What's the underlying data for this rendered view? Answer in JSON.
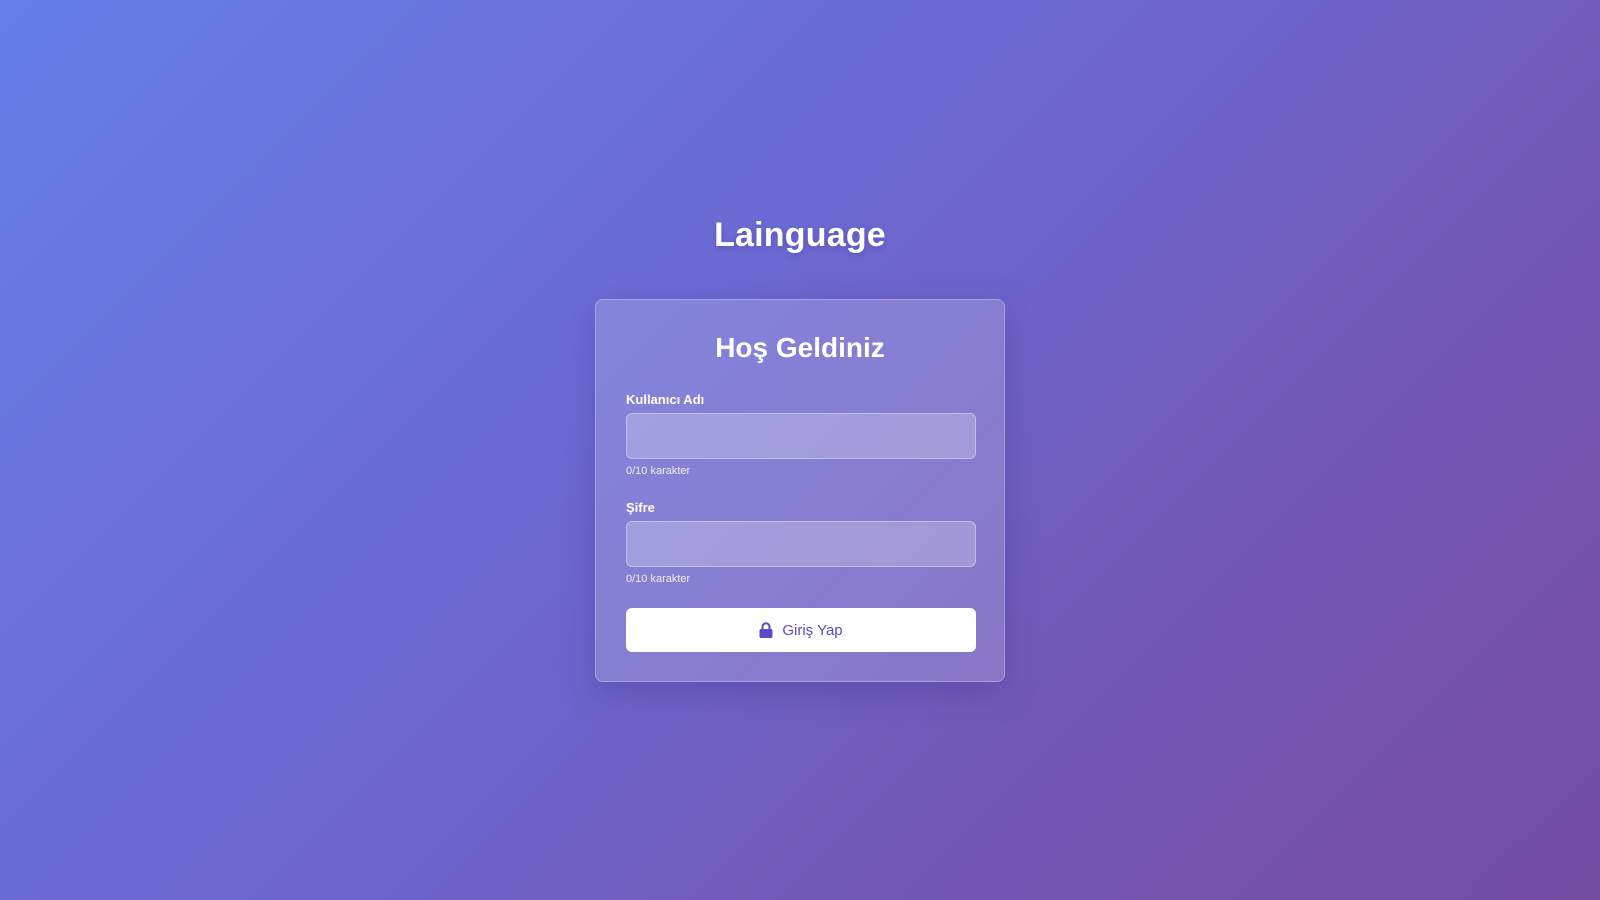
{
  "app": {
    "title": "Lainguage"
  },
  "login": {
    "heading": "Hoş Geldiniz",
    "username": {
      "label": "Kullanıcı Adı",
      "value": "",
      "counter": "0/10 karakter"
    },
    "password": {
      "label": "Şifre",
      "value": "",
      "counter": "0/10 karakter"
    },
    "submit": {
      "label": "Giriş Yap",
      "icon": "lock-icon"
    }
  },
  "colors": {
    "gradient_start": "#667eea",
    "gradient_end": "#764ba2",
    "button_text": "#5a48c4",
    "button_background": "#ffffff"
  }
}
